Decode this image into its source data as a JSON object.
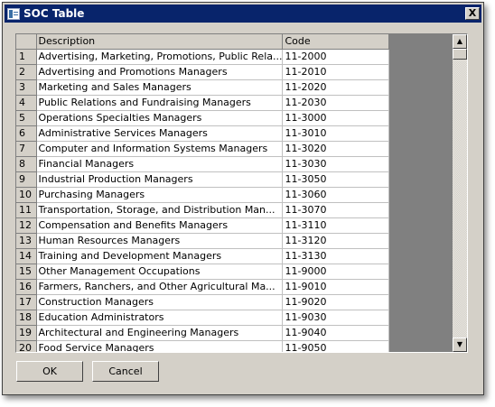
{
  "window": {
    "title": "SOC Table",
    "close_glyph": "X",
    "icon": "table-window-icon"
  },
  "table": {
    "columns": [
      "",
      "Description",
      "Code"
    ],
    "rows": [
      {
        "num": "1",
        "description": "Advertising, Marketing, Promotions, Public Rela...",
        "code": "11-2000"
      },
      {
        "num": "2",
        "description": "Advertising and Promotions Managers",
        "code": "11-2010"
      },
      {
        "num": "3",
        "description": "Marketing and Sales Managers",
        "code": "11-2020"
      },
      {
        "num": "4",
        "description": "Public Relations and Fundraising Managers",
        "code": "11-2030"
      },
      {
        "num": "5",
        "description": "Operations Specialties Managers",
        "code": "11-3000"
      },
      {
        "num": "6",
        "description": "Administrative Services Managers",
        "code": "11-3010"
      },
      {
        "num": "7",
        "description": "Computer and Information Systems Managers",
        "code": "11-3020"
      },
      {
        "num": "8",
        "description": "Financial Managers",
        "code": "11-3030"
      },
      {
        "num": "9",
        "description": "Industrial Production Managers",
        "code": "11-3050"
      },
      {
        "num": "10",
        "description": "Purchasing Managers",
        "code": "11-3060"
      },
      {
        "num": "11",
        "description": "Transportation, Storage, and Distribution Man...",
        "code": "11-3070"
      },
      {
        "num": "12",
        "description": "Compensation and Benefits Managers",
        "code": "11-3110"
      },
      {
        "num": "13",
        "description": "Human Resources Managers",
        "code": "11-3120"
      },
      {
        "num": "14",
        "description": "Training and Development Managers",
        "code": "11-3130"
      },
      {
        "num": "15",
        "description": "Other Management Occupations",
        "code": "11-9000"
      },
      {
        "num": "16",
        "description": "Farmers, Ranchers, and Other Agricultural Ma...",
        "code": "11-9010"
      },
      {
        "num": "17",
        "description": "Construction Managers",
        "code": "11-9020"
      },
      {
        "num": "18",
        "description": "Education Administrators",
        "code": "11-9030"
      },
      {
        "num": "19",
        "description": "Architectural and Engineering Managers",
        "code": "11-9040"
      },
      {
        "num": "20",
        "description": "Food Service Managers",
        "code": "11-9050"
      }
    ]
  },
  "scrollbar": {
    "up_glyph": "▲",
    "down_glyph": "▼"
  },
  "buttons": {
    "ok_label": "OK",
    "cancel_label": "Cancel"
  },
  "colors": {
    "titlebar": "#08246b",
    "dialog_face": "#d4d0c8",
    "grid_background": "#808080"
  }
}
